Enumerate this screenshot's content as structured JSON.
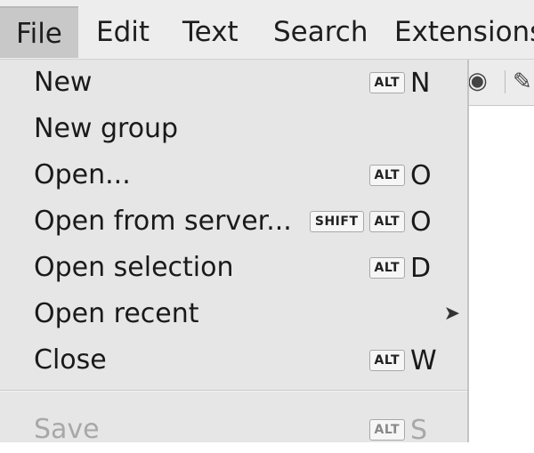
{
  "menubar": {
    "items": [
      {
        "label": "File"
      },
      {
        "label": "Edit"
      },
      {
        "label": "Text"
      },
      {
        "label": "Search"
      },
      {
        "label": "Extensions"
      }
    ]
  },
  "toolbar": {
    "icons": [
      "globe-icon",
      "pencil-icon"
    ]
  },
  "file_menu": {
    "items": [
      {
        "label": "New",
        "mods": [
          "ALT"
        ],
        "key": "N"
      },
      {
        "label": "New group",
        "mods": [],
        "key": ""
      },
      {
        "label": "Open...",
        "mods": [
          "ALT"
        ],
        "key": "O"
      },
      {
        "label": "Open from server...",
        "mods": [
          "SHIFT",
          "ALT"
        ],
        "key": "O"
      },
      {
        "label": "Open selection",
        "mods": [
          "ALT"
        ],
        "key": "D"
      },
      {
        "label": "Open recent",
        "mods": [],
        "key": "",
        "submenu": true
      },
      {
        "label": "Close",
        "mods": [
          "ALT"
        ],
        "key": "W"
      },
      {
        "label": "Save",
        "mods": [
          "ALT"
        ],
        "key": "S",
        "disabled": true
      }
    ]
  }
}
